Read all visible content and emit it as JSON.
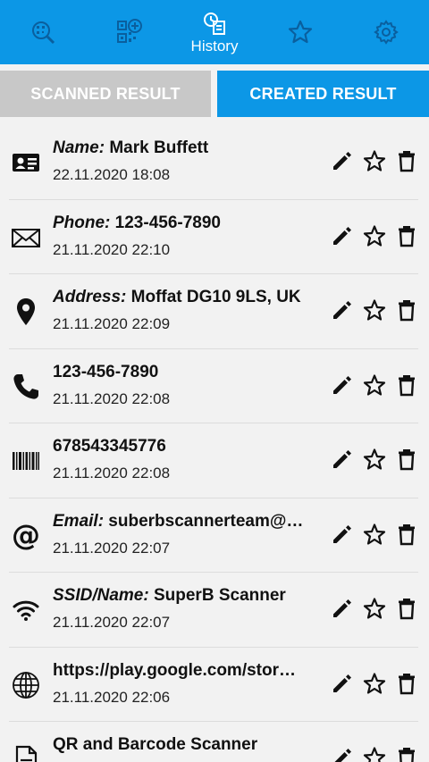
{
  "nav": {
    "items": [
      {
        "name": "scan-nav",
        "icon": "qr-scan-icon"
      },
      {
        "name": "create-nav",
        "icon": "qr-create-icon"
      },
      {
        "name": "history-nav",
        "icon": "history-icon",
        "label": "History"
      },
      {
        "name": "favorites-nav",
        "icon": "star-icon"
      },
      {
        "name": "settings-nav",
        "icon": "gear-icon"
      }
    ],
    "active_color": "#ffffff",
    "inactive_color": "#0a5f9e"
  },
  "tabs": {
    "scanned": "SCANNED RESULT",
    "created": "CREATED RESULT"
  },
  "colors": {
    "accent": "#0c97e6",
    "tab_inactive": "#c8c8c8"
  },
  "rows": [
    {
      "icon": "contact-card-icon",
      "key": "Name:",
      "value": " Mark Buffett",
      "date": "22.11.2020 18:08"
    },
    {
      "icon": "mail-icon",
      "key": "Phone:",
      "value": " 123-456-7890",
      "date": "21.11.2020 22:10"
    },
    {
      "icon": "location-icon",
      "key": "Address:",
      "value": " Moffat DG10 9LS, UK",
      "date": "21.11.2020 22:09"
    },
    {
      "icon": "phone-icon",
      "key": "",
      "value": "123-456-7890",
      "date": "21.11.2020 22:08"
    },
    {
      "icon": "barcode-icon",
      "key": "",
      "value": "678543345776",
      "date": "21.11.2020 22:08"
    },
    {
      "icon": "at-icon",
      "key": "Email:",
      "value": " suberbscannerteam@…",
      "date": "21.11.2020 22:07"
    },
    {
      "icon": "wifi-icon",
      "key": "SSID/Name:",
      "value": " SuperB Scanner",
      "date": "21.11.2020 22:07"
    },
    {
      "icon": "globe-icon",
      "key": "",
      "value": "https://play.google.com/stor…",
      "date": "21.11.2020 22:06"
    },
    {
      "icon": "document-icon",
      "key": "",
      "value": "QR and Barcode Scanner",
      "date": ""
    }
  ]
}
